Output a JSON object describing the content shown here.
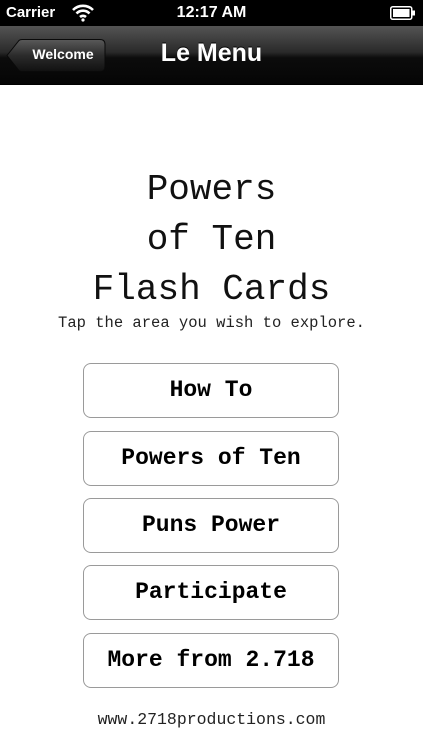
{
  "status_bar": {
    "carrier": "Carrier",
    "time": "12:17 AM",
    "icons": [
      "wifi-icon",
      "battery-icon"
    ]
  },
  "nav_bar": {
    "back_label": "Welcome",
    "title": "Le Menu"
  },
  "main": {
    "title_lines": [
      "Powers",
      "of Ten",
      "Flash Cards"
    ],
    "subtitle": "Tap the area you wish to explore.",
    "buttons": [
      {
        "label": "How To"
      },
      {
        "label": "Powers of Ten"
      },
      {
        "label": "Puns Power"
      },
      {
        "label": "Participate"
      },
      {
        "label": "More from 2.718"
      }
    ],
    "footer_link": "www.2718productions.com"
  },
  "colors": {
    "status_bar_bg": "#000000",
    "nav_bar_bg": "#1a1a1a",
    "button_border": "#9a9a9a",
    "text": "#000000"
  }
}
